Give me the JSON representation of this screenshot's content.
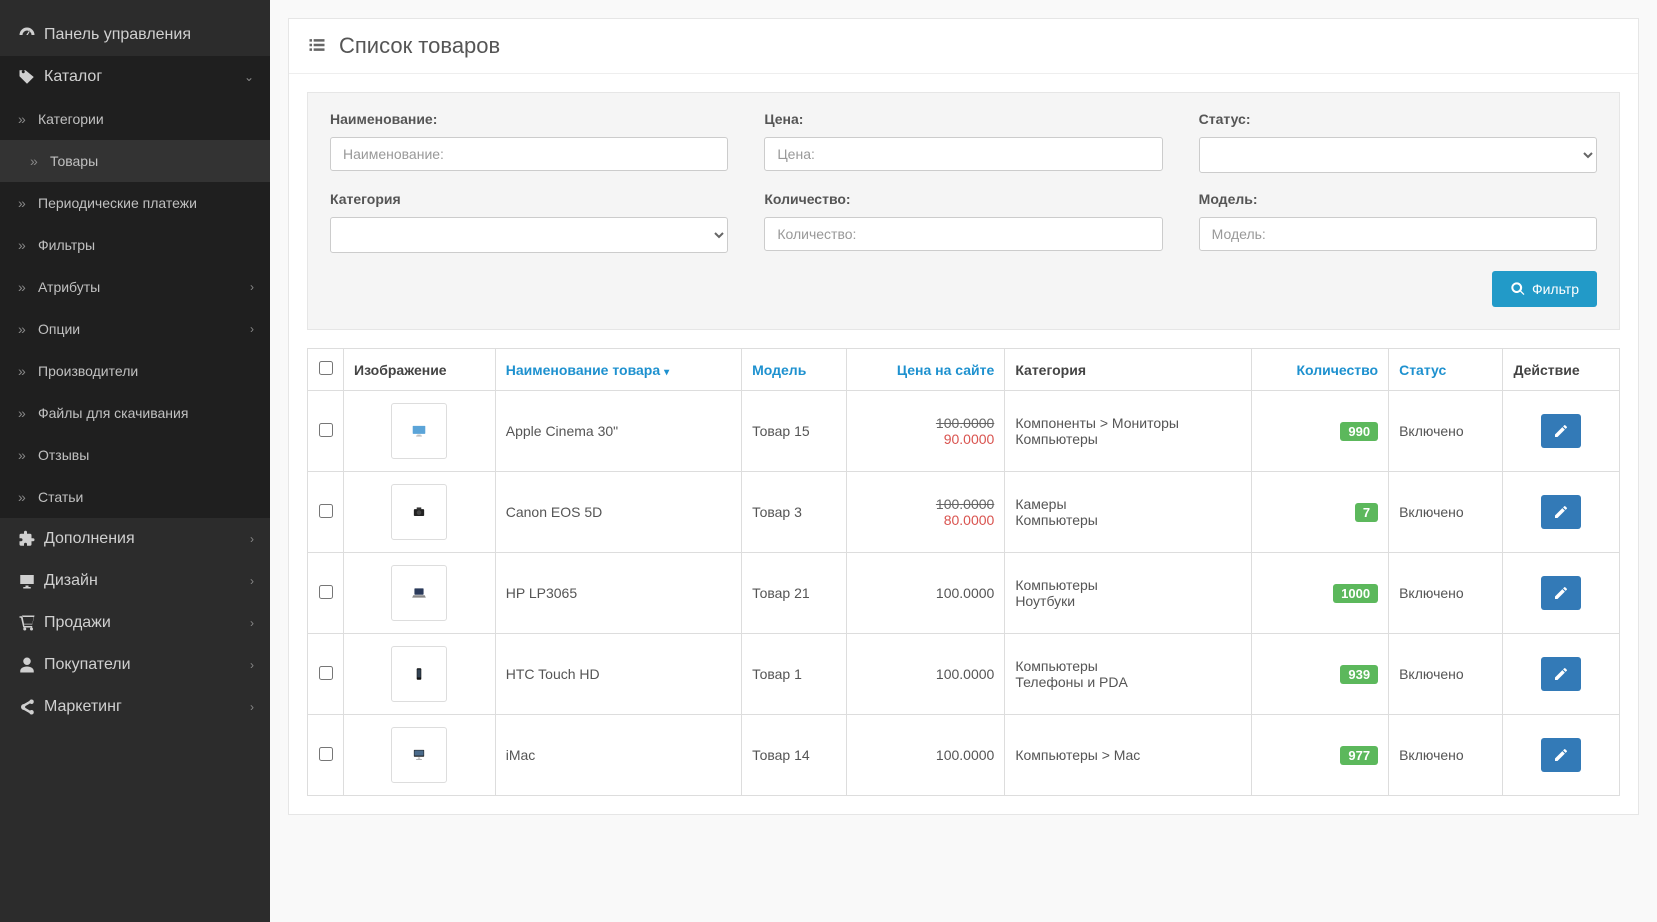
{
  "sidebar": {
    "items": [
      {
        "label": "Панель управления",
        "icon": "dashboard"
      },
      {
        "label": "Каталог",
        "icon": "tag",
        "expanded": true,
        "chevron": "down",
        "children": [
          {
            "label": "Категории"
          },
          {
            "label": "Товары",
            "active": true
          },
          {
            "label": "Периодические платежи"
          },
          {
            "label": "Фильтры"
          },
          {
            "label": "Атрибуты",
            "chevron": "right"
          },
          {
            "label": "Опции",
            "chevron": "right"
          },
          {
            "label": "Производители"
          },
          {
            "label": "Файлы для скачивания"
          },
          {
            "label": "Отзывы"
          },
          {
            "label": "Статьи"
          }
        ]
      },
      {
        "label": "Дополнения",
        "icon": "puzzle",
        "chevron": "right"
      },
      {
        "label": "Дизайн",
        "icon": "monitor",
        "chevron": "right"
      },
      {
        "label": "Продажи",
        "icon": "cart",
        "chevron": "right"
      },
      {
        "label": "Покупатели",
        "icon": "user",
        "chevron": "right"
      },
      {
        "label": "Маркетинг",
        "icon": "share",
        "chevron": "right"
      }
    ]
  },
  "page": {
    "title": "Список товаров"
  },
  "filter": {
    "name": {
      "label": "Наименование:",
      "placeholder": "Наименование:"
    },
    "price": {
      "label": "Цена:",
      "placeholder": "Цена:"
    },
    "status": {
      "label": "Статус:"
    },
    "category": {
      "label": "Категория"
    },
    "quantity": {
      "label": "Количество:",
      "placeholder": "Количество:"
    },
    "model": {
      "label": "Модель:",
      "placeholder": "Модель:"
    },
    "button": "Фильтр"
  },
  "table": {
    "headers": {
      "image": "Изображение",
      "name": "Наименование товара",
      "model": "Модель",
      "price": "Цена на сайте",
      "category": "Категория",
      "quantity": "Количество",
      "status": "Статус",
      "action": "Действие"
    },
    "rows": [
      {
        "name": "Apple Cinema 30\"",
        "model": "Товар 15",
        "price_old": "100.0000",
        "price_new": "90.0000",
        "categories": [
          "Компоненты  >  Мониторы",
          "Компьютеры"
        ],
        "qty": "990",
        "status": "Включено",
        "thumb": "monitor"
      },
      {
        "name": "Canon EOS 5D",
        "model": "Товар 3",
        "price_old": "100.0000",
        "price_new": "80.0000",
        "categories": [
          "Камеры",
          "Компьютеры"
        ],
        "qty": "7",
        "status": "Включено",
        "thumb": "camera"
      },
      {
        "name": "HP LP3065",
        "model": "Товар 21",
        "price": "100.0000",
        "categories": [
          "Компьютеры",
          "Ноутбуки"
        ],
        "qty": "1000",
        "status": "Включено",
        "thumb": "laptop"
      },
      {
        "name": "HTC Touch HD",
        "model": "Товар 1",
        "price": "100.0000",
        "categories": [
          "Компьютеры",
          "Телефоны и PDA"
        ],
        "qty": "939",
        "status": "Включено",
        "thumb": "phone"
      },
      {
        "name": "iMac",
        "model": "Товар 14",
        "price": "100.0000",
        "categories": [
          "Компьютеры  >  Mac"
        ],
        "qty": "977",
        "status": "Включено",
        "thumb": "imac"
      }
    ]
  }
}
